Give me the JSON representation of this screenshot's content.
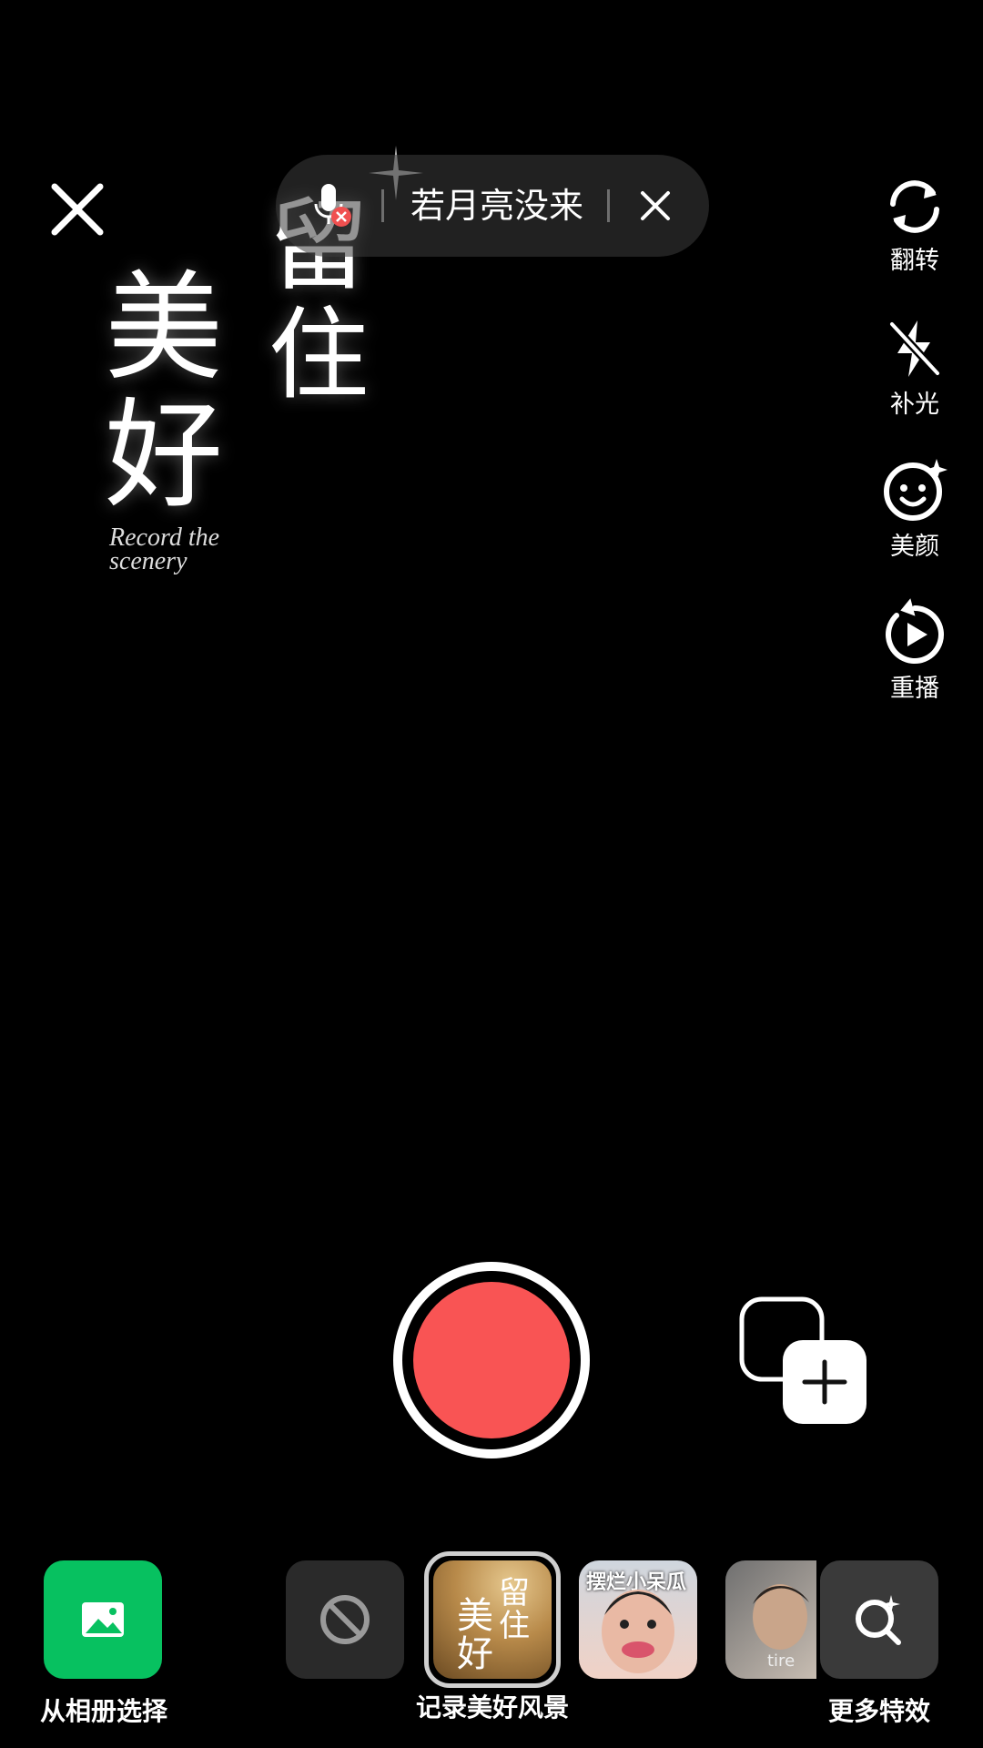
{
  "top": {
    "close_icon": "close-icon",
    "music": {
      "mic_icon": "mic-muted-icon",
      "title": "若月亮没来",
      "close_icon": "close-icon"
    }
  },
  "effect_overlay": {
    "chars": [
      "美",
      "好",
      "留",
      "住"
    ],
    "subtitle": "Record the scenery"
  },
  "toolbar": {
    "items": [
      {
        "label": "翻转",
        "icon": "flip-camera-icon"
      },
      {
        "label": "补光",
        "icon": "flash-off-icon"
      },
      {
        "label": "美颜",
        "icon": "beauty-face-icon"
      },
      {
        "label": "重播",
        "icon": "replay-icon"
      }
    ]
  },
  "record": {
    "color": "#f95454",
    "icon": "record-button"
  },
  "bottom": {
    "album_label": "从相册选择",
    "album_color": "#07c160",
    "selected_effect_label": "记录美好风景",
    "selected_effect_chars": [
      "美",
      "好",
      "留",
      "住"
    ],
    "face_effect_text": "摆烂小呆瓜",
    "kid_effect_text": "tire",
    "more_label": "更多特效"
  }
}
